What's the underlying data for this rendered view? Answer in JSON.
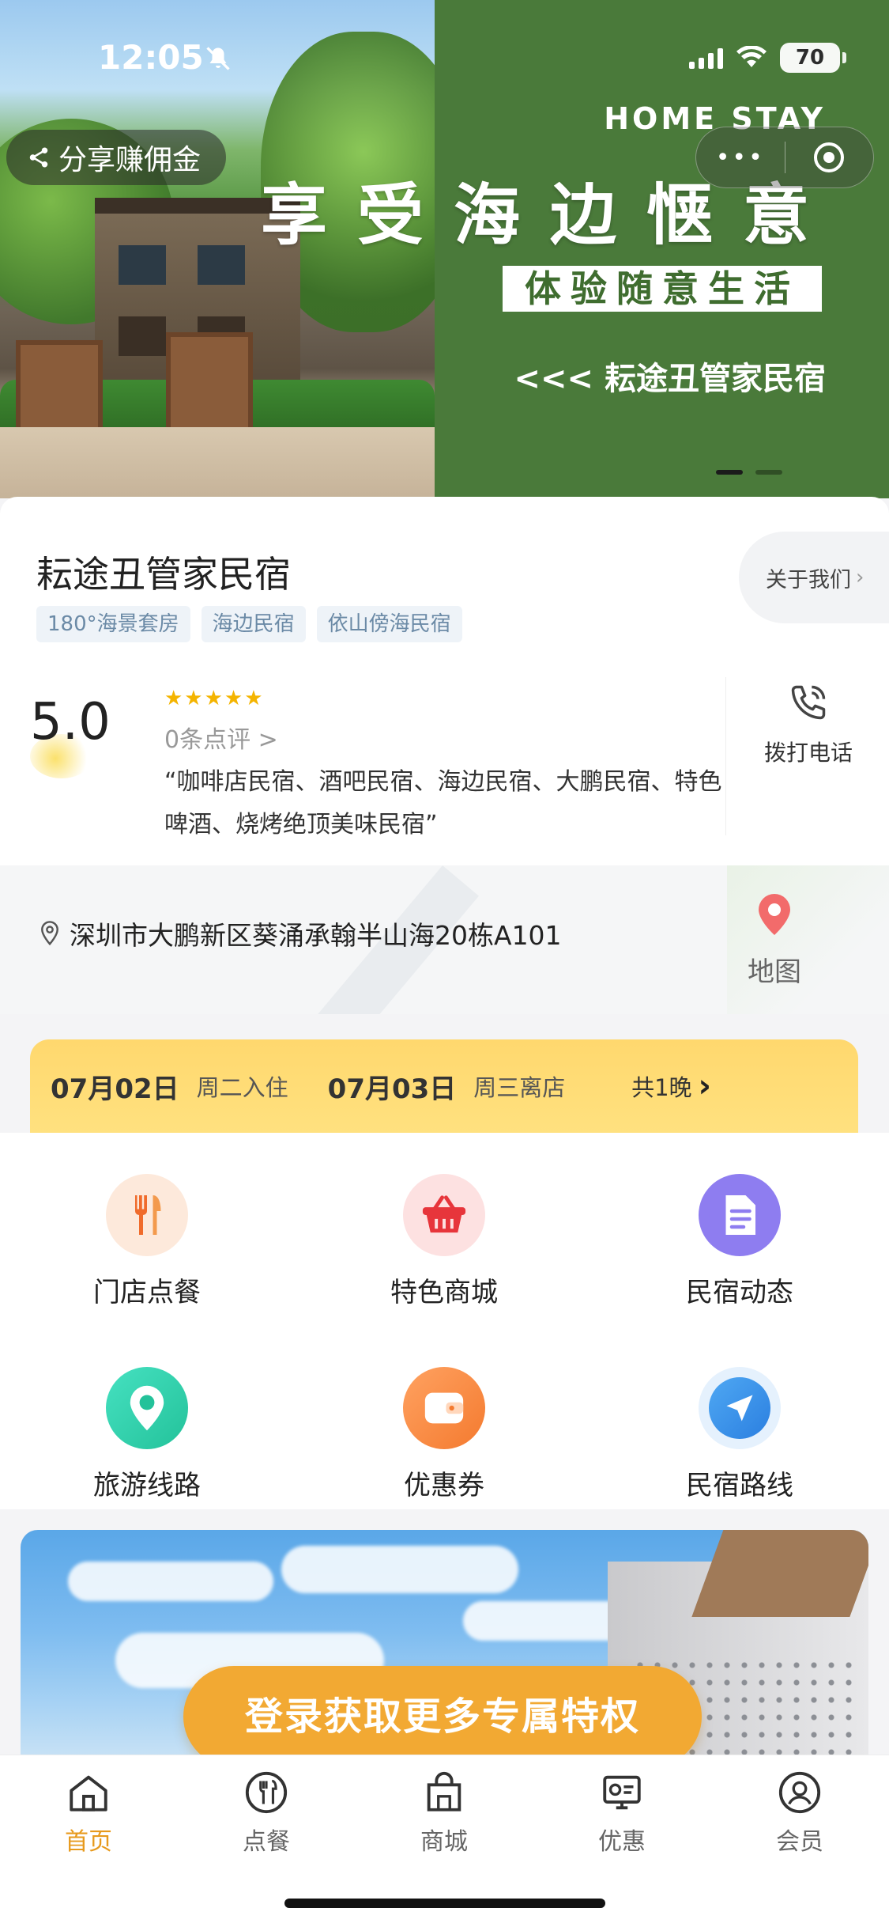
{
  "status": {
    "time": "12:05",
    "battery": "70"
  },
  "hero": {
    "share_label": "分享赚佣金",
    "capsule_more": "•••",
    "brand_en": "HOME STAY",
    "headline": "享受海边惬意",
    "sub_box": "体验随意生活",
    "tagline": "<<<  耘途丑管家民宿",
    "slides": 2,
    "active_slide": 1
  },
  "shop": {
    "name": "耘途丑管家民宿",
    "tags": [
      "180°海景套房",
      "海边民宿",
      "依山傍海民宿"
    ],
    "about_label": "关于我们",
    "score": "5.0",
    "stars": "★★★★★",
    "reviews_label": "0条点评 >",
    "quote": "“咖啡店民宿、酒吧民宿、海边民宿、大鹏民宿、特色啤酒、烧烤绝顶美味民宿”",
    "call_label": "拨打电话"
  },
  "location": {
    "address": "深圳市大鹏新区葵涌承翰半山海20栋A101",
    "map_label": "地图"
  },
  "booking": {
    "checkin_date": "07月02日",
    "checkin_label": "周二入住",
    "checkout_date": "07月03日",
    "checkout_label": "周三离店",
    "nights_label": "共1晚"
  },
  "services": [
    {
      "label": "门店点餐",
      "icon": "fork-knife-icon"
    },
    {
      "label": "特色商城",
      "icon": "basket-icon"
    },
    {
      "label": "民宿动态",
      "icon": "document-icon"
    },
    {
      "label": "旅游线路",
      "icon": "location-pin-icon"
    },
    {
      "label": "优惠券",
      "icon": "wallet-icon"
    },
    {
      "label": "民宿路线",
      "icon": "navigation-arrow-icon"
    }
  ],
  "promo": {
    "cta_label": "登录获取更多专属特权"
  },
  "tabbar": {
    "items": [
      {
        "label": "首页",
        "icon": "home-icon",
        "active": true
      },
      {
        "label": "点餐",
        "icon": "dining-icon",
        "active": false
      },
      {
        "label": "商城",
        "icon": "shopping-bag-icon",
        "active": false
      },
      {
        "label": "优惠",
        "icon": "coupon-icon",
        "active": false
      },
      {
        "label": "会员",
        "icon": "member-icon",
        "active": false
      }
    ]
  },
  "colors": {
    "accent": "#e79a1d",
    "hero_green": "#4a7a3a",
    "date_bar": "#ffd86e",
    "cta": "#f2a933"
  }
}
